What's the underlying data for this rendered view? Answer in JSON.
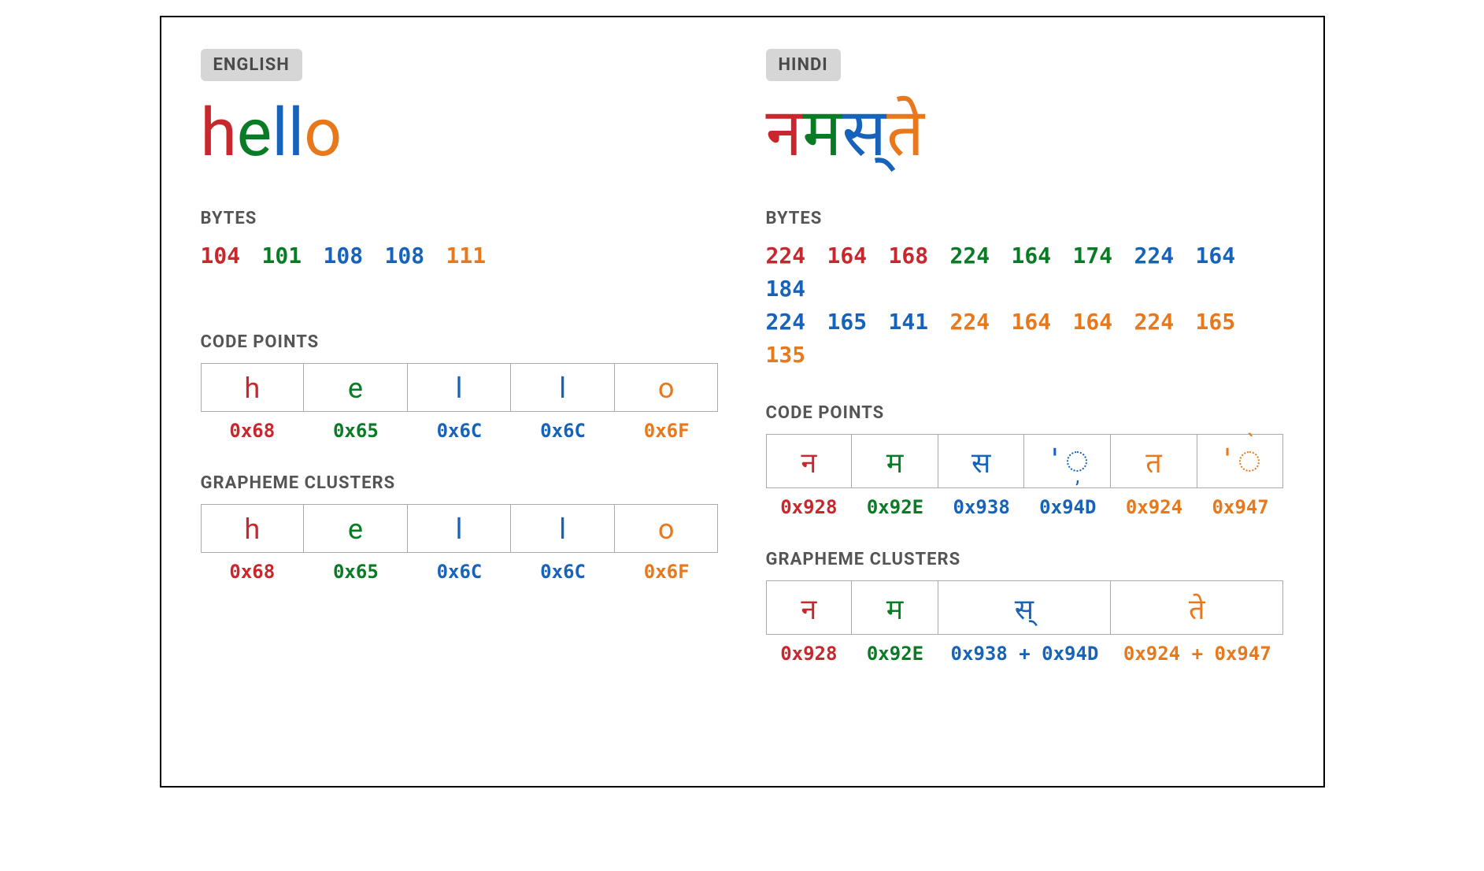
{
  "colors": {
    "red": "#c8282d",
    "green": "#0a7b25",
    "blue": "#1763b9",
    "orange": "#e8781c"
  },
  "labels": {
    "bytes": "BYTES",
    "code_points": "CODE POINTS",
    "grapheme_clusters": "GRAPHEME CLUSTERS"
  },
  "english": {
    "lang_label": "ENGLISH",
    "word_chars": [
      {
        "char": "h",
        "color": "red"
      },
      {
        "char": "e",
        "color": "green"
      },
      {
        "char": "l",
        "color": "blue"
      },
      {
        "char": "l",
        "color": "blue"
      },
      {
        "char": "o",
        "color": "orange"
      }
    ],
    "bytes": [
      {
        "val": "104",
        "color": "red"
      },
      {
        "val": "101",
        "color": "green"
      },
      {
        "val": "108",
        "color": "blue"
      },
      {
        "val": "108",
        "color": "blue"
      },
      {
        "val": "111",
        "color": "orange"
      }
    ],
    "code_points": [
      {
        "glyph": "h",
        "hex": "0x68",
        "color": "red"
      },
      {
        "glyph": "e",
        "hex": "0x65",
        "color": "green"
      },
      {
        "glyph": "l",
        "hex": "0x6C",
        "color": "blue"
      },
      {
        "glyph": "l",
        "hex": "0x6C",
        "color": "blue"
      },
      {
        "glyph": "o",
        "hex": "0x6F",
        "color": "orange"
      }
    ],
    "grapheme_clusters": [
      {
        "glyph": "h",
        "hex": "0x68",
        "color": "red",
        "span": 1
      },
      {
        "glyph": "e",
        "hex": "0x65",
        "color": "green",
        "span": 1
      },
      {
        "glyph": "l",
        "hex": "0x6C",
        "color": "blue",
        "span": 1
      },
      {
        "glyph": "l",
        "hex": "0x6C",
        "color": "blue",
        "span": 1
      },
      {
        "glyph": "o",
        "hex": "0x6F",
        "color": "orange",
        "span": 1
      }
    ]
  },
  "hindi": {
    "lang_label": "HINDI",
    "word_chars": [
      {
        "char": "न",
        "color": "red"
      },
      {
        "char": "म",
        "color": "green"
      },
      {
        "char": "स्",
        "color": "blue"
      },
      {
        "char": "ते",
        "color": "orange"
      }
    ],
    "bytes": [
      {
        "val": "224",
        "color": "red"
      },
      {
        "val": "164",
        "color": "red"
      },
      {
        "val": "168",
        "color": "red"
      },
      {
        "val": "224",
        "color": "green"
      },
      {
        "val": "164",
        "color": "green"
      },
      {
        "val": "174",
        "color": "green"
      },
      {
        "val": "224",
        "color": "blue"
      },
      {
        "val": "164",
        "color": "blue"
      },
      {
        "val": "184",
        "color": "blue"
      },
      {
        "val": "224",
        "color": "blue"
      },
      {
        "val": "165",
        "color": "blue"
      },
      {
        "val": "141",
        "color": "blue"
      },
      {
        "val": "224",
        "color": "orange"
      },
      {
        "val": "164",
        "color": "orange"
      },
      {
        "val": "164",
        "color": "orange"
      },
      {
        "val": "224",
        "color": "orange"
      },
      {
        "val": "165",
        "color": "orange"
      },
      {
        "val": "135",
        "color": "orange"
      }
    ],
    "code_points": [
      {
        "glyph": "न",
        "hex": "0x928",
        "color": "red"
      },
      {
        "glyph": "म",
        "hex": "0x92E",
        "color": "green"
      },
      {
        "glyph": "स",
        "hex": "0x938",
        "color": "blue"
      },
      {
        "glyph": "◌्",
        "hex": "0x94D",
        "color": "blue",
        "combining": "below"
      },
      {
        "glyph": "त",
        "hex": "0x924",
        "color": "orange"
      },
      {
        "glyph": "◌े",
        "hex": "0x947",
        "color": "orange",
        "combining": "above"
      }
    ],
    "grapheme_clusters": [
      {
        "glyph": "न",
        "hex": "0x928",
        "color": "red",
        "span": 1
      },
      {
        "glyph": "म",
        "hex": "0x92E",
        "color": "green",
        "span": 1
      },
      {
        "glyph": "स्",
        "hex": "0x938 + 0x94D",
        "color": "blue",
        "span": 2
      },
      {
        "glyph": "ते",
        "hex": "0x924 + 0x947",
        "color": "orange",
        "span": 2
      }
    ]
  }
}
